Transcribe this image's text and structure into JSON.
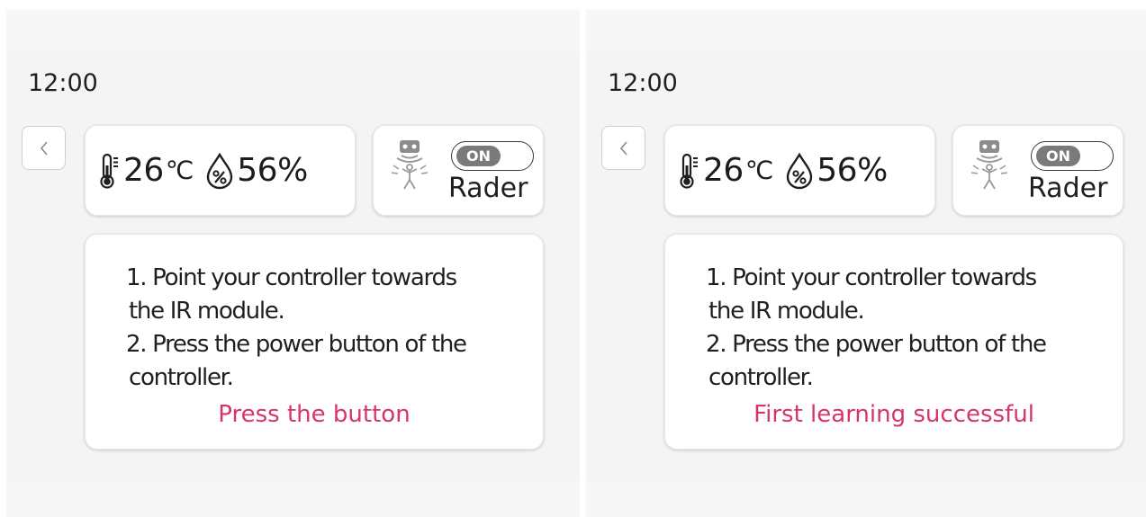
{
  "colors": {
    "panel_bg": "#f4f4f4",
    "accent_status": "#d6356a",
    "card_bg": "#ffffff",
    "toggle_knob": "#7a7a7a"
  },
  "screens": [
    {
      "time": "12:00",
      "temperature": "26",
      "temperature_unit": "℃",
      "humidity": "56%",
      "radar": {
        "toggle_label": "ON",
        "label": "Rader"
      },
      "instructions": {
        "step1_line1": "1. Point your controller towards",
        "step1_line2": "the IR module.",
        "step2_line1": "2. Press the power button of the",
        "step2_line2": "controller."
      },
      "status": "Press the button"
    },
    {
      "time": "12:00",
      "temperature": "26",
      "temperature_unit": "℃",
      "humidity": "56%",
      "radar": {
        "toggle_label": "ON",
        "label": "Rader"
      },
      "instructions": {
        "step1_line1": "1. Point your controller towards",
        "step1_line2": "the IR module.",
        "step2_line1": "2. Press the power button of the",
        "step2_line2": "controller."
      },
      "status": "First learning successful"
    }
  ],
  "icons": [
    "back-chevron-icon",
    "thermometer-icon",
    "humidity-drop-icon",
    "radar-sensor-icon"
  ]
}
